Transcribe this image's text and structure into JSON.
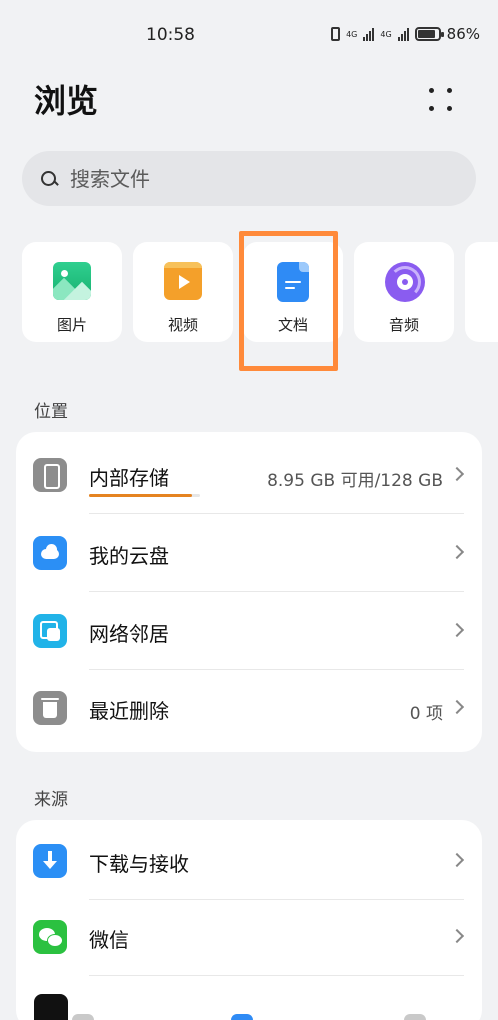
{
  "status_bar": {
    "time": "10:58",
    "net_a": "4G",
    "net_b": "4G",
    "battery": "86%",
    "battery_level": 0.86
  },
  "header": {
    "title": "浏览",
    "more_icon": "more-vertical-dots-icon"
  },
  "search": {
    "placeholder": "搜索文件",
    "icon": "search-icon"
  },
  "categories": [
    {
      "label": "图片",
      "icon": "image-icon",
      "color": "#1fbf7f"
    },
    {
      "label": "视频",
      "icon": "video-icon",
      "color": "#f4a02a"
    },
    {
      "label": "文档",
      "icon": "document-icon",
      "color": "#2f8bf5"
    },
    {
      "label": "音频",
      "icon": "audio-icon",
      "color": "#8a5cf0"
    }
  ],
  "highlight_color": "#ff8a3a",
  "locations": {
    "label": "位置",
    "items": [
      {
        "label": "内部存储",
        "value": "8.95 GB 可用/128 GB",
        "icon": "phone-icon",
        "usage_fraction": 0.93
      },
      {
        "label": "我的云盘",
        "value": "",
        "icon": "cloud-icon"
      },
      {
        "label": "网络邻居",
        "value": "",
        "icon": "network-icon"
      },
      {
        "label": "最近删除",
        "value": "0 项",
        "icon": "trash-icon"
      }
    ]
  },
  "sources": {
    "label": "来源",
    "items": [
      {
        "label": "下载与接收",
        "icon": "download-icon"
      },
      {
        "label": "微信",
        "icon": "wechat-icon"
      }
    ]
  }
}
